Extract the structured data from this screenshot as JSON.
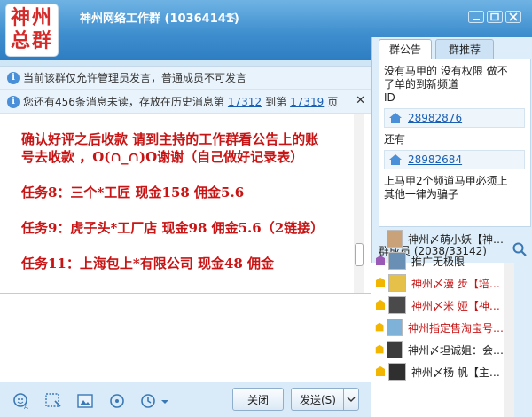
{
  "window": {
    "logo_line1": "神州",
    "logo_line2": "总群",
    "title": "神州网络工作群 (10364141)"
  },
  "notices": {
    "line1": "当前该群仅允许管理员发言，普通成员不可发言",
    "line2_prefix": "您还有456条消息未读，存放在历史消息第",
    "page_from": "17312",
    "to_label": "到第",
    "page_to": "17319",
    "page_suffix": "页"
  },
  "chat": {
    "messages": [
      "确认好评之后收款 请到主持的工作群看公告上的账号去收款 ，O(∩_∩)O谢谢（自己做好记录表）",
      "任务8：三个*工匠    现金158    佣金5.6",
      "任务9：虎子头*工厂店    现金98    佣金5.6（2链接）",
      "任务11：上海包上*有限公司    现金48    佣金"
    ]
  },
  "toolbar": {
    "close_label": "关闭",
    "send_label": "发送(S)"
  },
  "right_panel": {
    "tab_announce": "群公告",
    "tab_recommend": "群推荐",
    "announce_line1": "没有马甲的 没有权限 做不",
    "announce_line2": "了单的到新频道",
    "announce_line3": "ID",
    "announce_link1": "28982876",
    "announce_line4": "还有",
    "announce_link2": "28982684",
    "announce_line5": "上马甲2个频道马甲必须上",
    "announce_line6": "其他一律为骗子",
    "members_header": "群成员 (2038/33142)"
  },
  "members": [
    {
      "name": "神州〆萌小妖【神…",
      "red": false
    },
    {
      "name": "推广无极限",
      "red": false
    },
    {
      "name": "神州〆漫 步【培…",
      "red": true
    },
    {
      "name": "神州〆米 娅【神…",
      "red": true
    },
    {
      "name": "神州指定售淘宝号…",
      "red": true
    },
    {
      "name": "神州〆坦诚姐：会…",
      "red": false
    },
    {
      "name": "神州〆杨 帆【主…",
      "red": false
    }
  ],
  "colors": {
    "accent_red": "#c81414",
    "title_blue": "#3f8fcf",
    "link_blue": "#1a5fb4"
  }
}
